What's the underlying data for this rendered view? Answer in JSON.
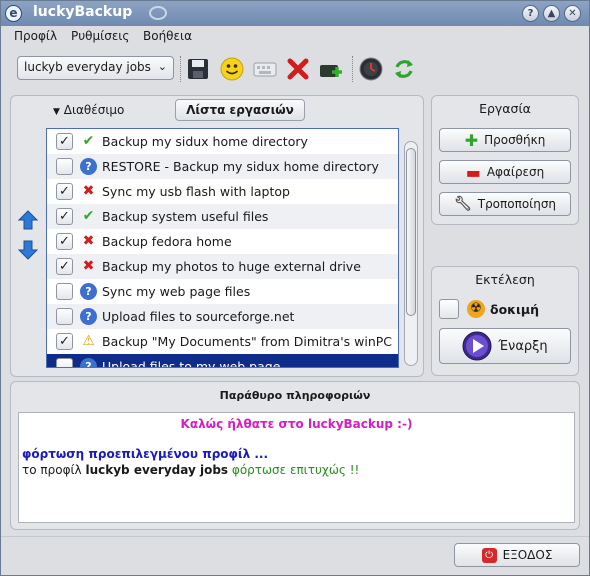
{
  "window": {
    "title": "luckyBackup"
  },
  "menu": [
    {
      "label": "Προφίλ"
    },
    {
      "label": "Ρυθμίσεις"
    },
    {
      "label": "Βοήθεια"
    }
  ],
  "toolbar": {
    "profile_selected": "luckyb everyday jobs",
    "icons": [
      "save-icon",
      "smiley-icon",
      "keyboard-icon",
      "delete-icon",
      "add-tray-icon",
      "clock-icon",
      "refresh-icon"
    ]
  },
  "tasks_panel": {
    "tab_available": "Διαθέσιμο",
    "tab_list": "Λίστα εργασιών",
    "tasks": [
      {
        "label": "Backup my sidux home directory",
        "checked": true,
        "status": "ok"
      },
      {
        "label": "RESTORE - Backup my sidux home directory",
        "checked": false,
        "status": "info"
      },
      {
        "label": "Sync my usb flash with laptop",
        "checked": true,
        "status": "fail"
      },
      {
        "label": "Backup system useful files",
        "checked": true,
        "status": "ok"
      },
      {
        "label": "Backup fedora home",
        "checked": true,
        "status": "fail"
      },
      {
        "label": "Backup my photos to huge external drive",
        "checked": true,
        "status": "fail"
      },
      {
        "label": "Sync my web page files",
        "checked": false,
        "status": "info"
      },
      {
        "label": "Upload files to sourceforge.net",
        "checked": false,
        "status": "info"
      },
      {
        "label": "Backup \"My Documents\" from Dimitra's winPC",
        "checked": true,
        "status": "warn"
      },
      {
        "label": "Upload files to my web page",
        "checked": false,
        "status": "info"
      }
    ]
  },
  "task_group": {
    "title": "Εργασία",
    "add": "Προσθήκη",
    "remove": "Αφαίρεση",
    "modify": "Τροποποίηση"
  },
  "run_group": {
    "title": "Εκτέλεση",
    "dry_run": "δοκιμή",
    "start": "Έναρξη"
  },
  "info_window": {
    "title": "Παράθυρο πληροφοριών",
    "welcome": "Καλώς ήλθατε στο luckyBackup :-)",
    "loading": "φόρτωση προεπιλεγμένου προφίλ ...",
    "result_prefix": "το προφίλ",
    "result_profile": "luckyb everyday jobs",
    "result_suffix": "φόρτωσε επιτυχώς !!"
  },
  "exit_button": "ΕΞΟΔΟΣ",
  "colors": {
    "welcome": "#d21fc4",
    "loading": "#1b1bb8",
    "success": "#2a8c1e",
    "selection": "#0f2c8a"
  }
}
